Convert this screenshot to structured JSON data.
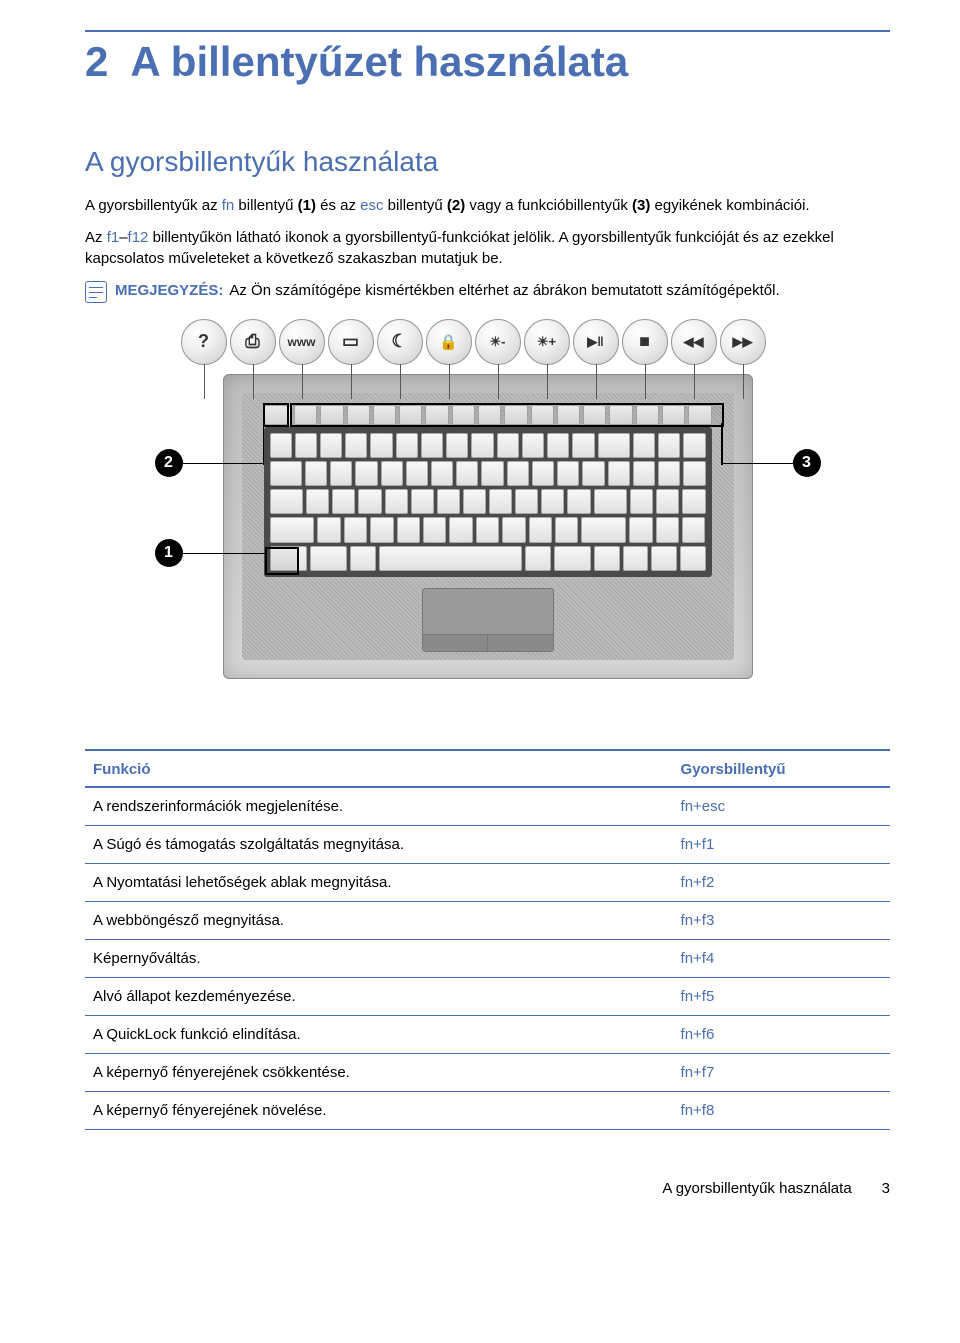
{
  "chapter": {
    "number": "2",
    "title": "A billentyűzet használata"
  },
  "section_title": "A gyorsbillentyűk használata",
  "paragraphs": {
    "p1_a": "A gyorsbillentyűk az ",
    "p1_fn": "fn",
    "p1_b": " billentyű ",
    "p1_ref1": "(1)",
    "p1_c": " és az ",
    "p1_esc": "esc",
    "p1_d": " billentyű ",
    "p1_ref2": "(2)",
    "p1_e": " vagy a funkcióbillentyűk ",
    "p1_ref3": "(3)",
    "p1_f": " egyikének kombinációi.",
    "p2_a": "Az ",
    "p2_f1": "f1",
    "p2_dash": "–",
    "p2_f12": "f12",
    "p2_b": " billentyűkön látható ikonok a gyorsbillentyű-funkciókat jelölik. A gyorsbillentyűk funkcióját és az ezekkel kapcsolatos műveleteket a következő szakaszban mutatjuk be."
  },
  "note": {
    "label": "MEGJEGYZÉS:",
    "text": "Az Ön számítógépe kismértékben eltérhet az ábrákon bemutatott számítógépektől."
  },
  "illustration": {
    "bubbles": [
      "?",
      "⎙",
      "www",
      "▭",
      "☾",
      "🔒",
      "☀-",
      "☀+",
      "▶‖",
      "■",
      "◀◀",
      "▶▶"
    ],
    "callouts": {
      "c1": "1",
      "c2": "2",
      "c3": "3"
    }
  },
  "table": {
    "headers": {
      "func": "Funkció",
      "hotkey": "Gyorsbillentyű"
    },
    "rows": [
      {
        "func": "A rendszerinformációk megjelenítése.",
        "hk": "fn+esc"
      },
      {
        "func": "A Súgó és támogatás szolgáltatás megnyitása.",
        "hk": "fn+f1"
      },
      {
        "func": "A Nyomtatási lehetőségek ablak megnyitása.",
        "hk": "fn+f2"
      },
      {
        "func": "A webböngésző megnyitása.",
        "hk": "fn+f3"
      },
      {
        "func": "Képernyőváltás.",
        "hk": "fn+f4"
      },
      {
        "func": "Alvó állapot kezdeményezése.",
        "hk": "fn+f5"
      },
      {
        "func": "A QuickLock funkció elindítása.",
        "hk": "fn+f6"
      },
      {
        "func": "A képernyő fényerejének csökkentése.",
        "hk": "fn+f7"
      },
      {
        "func": "A képernyő fényerejének növelése.",
        "hk": "fn+f8"
      }
    ]
  },
  "footer": {
    "title": "A gyorsbillentyűk használata",
    "page": "3"
  }
}
